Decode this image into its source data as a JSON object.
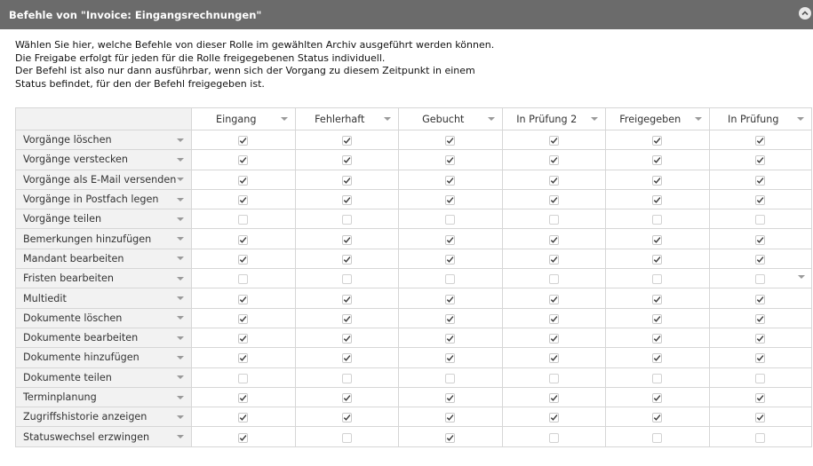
{
  "dialog": {
    "title": "Befehle von \"Invoice: Eingangsrechnungen\""
  },
  "description": [
    "Wählen Sie hier, welche Befehle von dieser Rolle im gewählten Archiv ausgeführt werden können.",
    "Die Freigabe erfolgt für jeden für die Rolle freigegebenen Status individuell.",
    "Der Befehl ist also nur dann ausführbar, wenn sich der Vorgang zu diesem Zeitpunkt in einem",
    "Status befindet, für den der Befehl freigegeben ist."
  ],
  "columns": [
    "Eingang",
    "Fehlerhaft",
    "Gebucht",
    "In Prüfung 2",
    "Freigegeben",
    "In Prüfung"
  ],
  "rows": [
    {
      "label": "Vorgänge löschen",
      "checks": [
        true,
        true,
        true,
        true,
        true,
        true
      ]
    },
    {
      "label": "Vorgänge verstecken",
      "checks": [
        true,
        true,
        true,
        true,
        true,
        true
      ]
    },
    {
      "label": "Vorgänge als E-Mail versenden",
      "checks": [
        true,
        true,
        true,
        true,
        true,
        true
      ]
    },
    {
      "label": "Vorgänge in Postfach legen",
      "checks": [
        true,
        true,
        true,
        true,
        true,
        true
      ]
    },
    {
      "label": "Vorgänge teilen",
      "checks": [
        false,
        false,
        false,
        false,
        false,
        false
      ]
    },
    {
      "label": "Bemerkungen hinzufügen",
      "checks": [
        true,
        true,
        true,
        true,
        true,
        true
      ]
    },
    {
      "label": "Mandant bearbeiten",
      "checks": [
        true,
        true,
        true,
        true,
        true,
        true
      ]
    },
    {
      "label": "Fristen bearbeiten",
      "checks": [
        false,
        false,
        false,
        false,
        false,
        false
      ]
    },
    {
      "label": "Multiedit",
      "checks": [
        true,
        true,
        true,
        true,
        true,
        true
      ]
    },
    {
      "label": "Dokumente löschen",
      "checks": [
        true,
        true,
        true,
        true,
        true,
        true
      ]
    },
    {
      "label": "Dokumente bearbeiten",
      "checks": [
        true,
        true,
        true,
        true,
        true,
        true
      ]
    },
    {
      "label": "Dokumente hinzufügen",
      "checks": [
        true,
        true,
        true,
        true,
        true,
        true
      ]
    },
    {
      "label": "Dokumente teilen",
      "checks": [
        false,
        false,
        false,
        false,
        false,
        false
      ]
    },
    {
      "label": "Terminplanung",
      "checks": [
        true,
        true,
        true,
        true,
        true,
        true
      ]
    },
    {
      "label": "Zugriffshistorie anzeigen",
      "checks": [
        true,
        true,
        true,
        true,
        true,
        true
      ]
    },
    {
      "label": "Statuswechsel erzwingen",
      "checks": [
        true,
        false,
        true,
        false,
        false,
        false
      ]
    }
  ],
  "icons": {
    "collapse": "chevron-up-icon",
    "dropdown": "caret-down-icon",
    "checked": "checkbox-checked-icon",
    "unchecked": "checkbox-unchecked-icon"
  },
  "colors": {
    "titlebar": "#6b6b6b",
    "rowheader_bg": "#f2f2f2",
    "grid_border": "#d6d6d6"
  }
}
